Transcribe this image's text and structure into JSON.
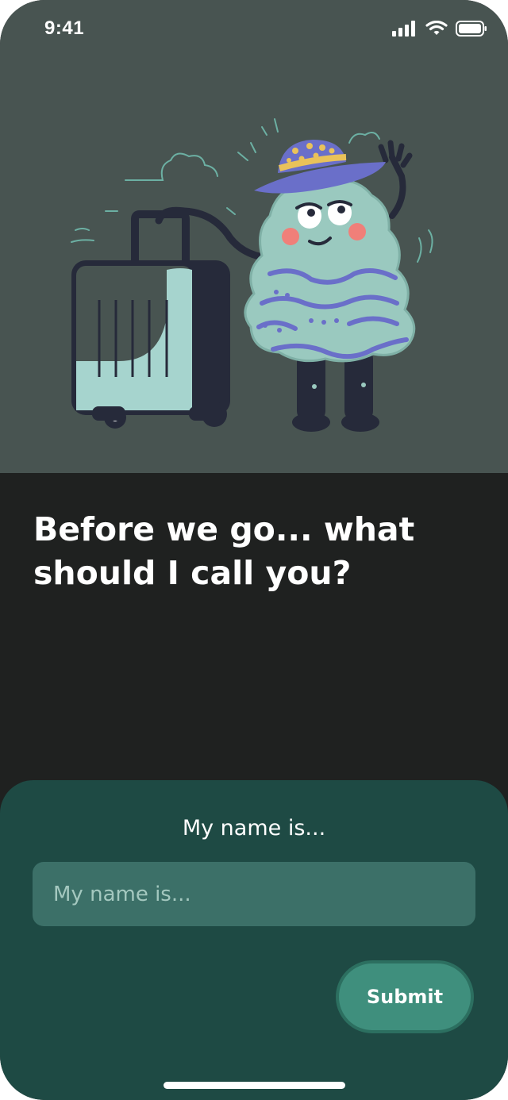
{
  "status_bar": {
    "time": "9:41",
    "icons": [
      "cellular-signal-icon",
      "wifi-icon",
      "battery-icon"
    ]
  },
  "illustration": {
    "name": "character-with-suitcase-illustration",
    "colors": {
      "background": "#485451",
      "character_body": "#9ac9bf",
      "character_stripes": "#6a6fc9",
      "hat": "#6a6fc9",
      "hat_dots": "#e9c25a",
      "suitcase_fill": "#a6d4ce",
      "outline": "#262a3a",
      "cheeks": "#f07f79"
    }
  },
  "headline": "Before we go... what should I call you?",
  "form": {
    "label": "My name is...",
    "input_value": "",
    "input_placeholder": "My name is...",
    "submit_label": "Submit"
  },
  "colors": {
    "screen_background": "#1f2120",
    "sheet_background": "#1e4a44",
    "input_background": "#3c7068",
    "button_background": "#3f8f7d",
    "text": "#ffffff"
  }
}
